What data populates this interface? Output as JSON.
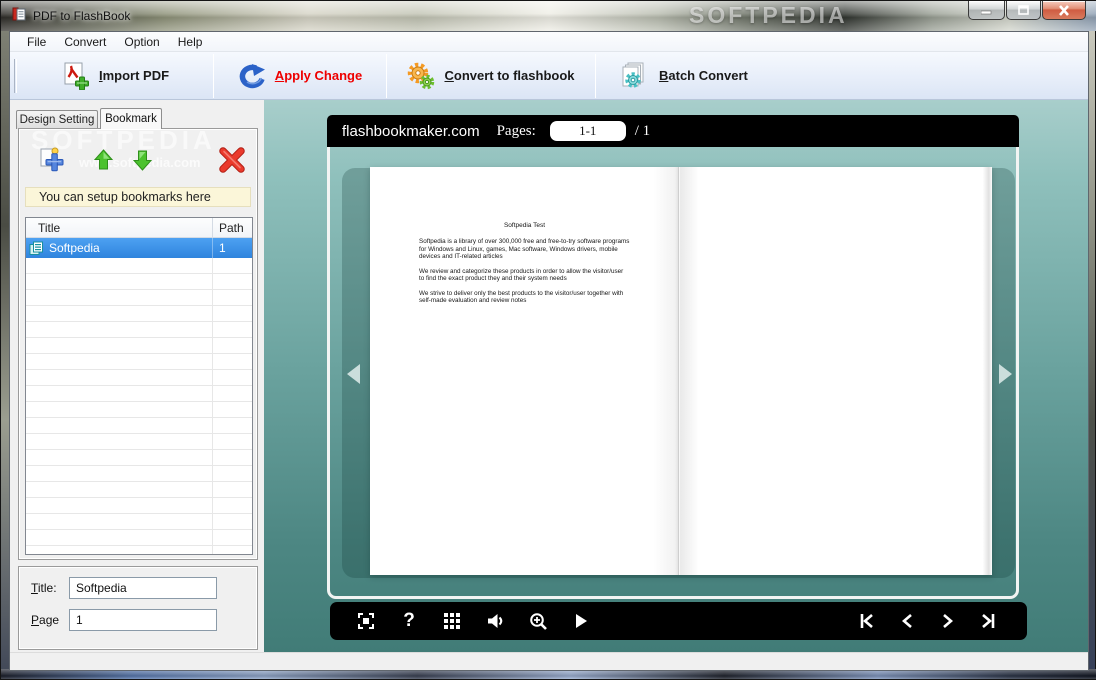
{
  "window": {
    "title": "PDF to FlashBook",
    "watermark": "SOFTPEDIA",
    "controls": [
      "minimize",
      "maximize",
      "close"
    ]
  },
  "menubar": {
    "items": [
      "File",
      "Convert",
      "Option",
      "Help"
    ]
  },
  "toolbar": {
    "buttons": [
      {
        "name": "import-pdf",
        "pre": "",
        "key": "I",
        "post": "mport PDF",
        "color": "#1a1a1a"
      },
      {
        "name": "apply-change",
        "pre": "",
        "key": "A",
        "post": "pply Change",
        "color": "#ee0000"
      },
      {
        "name": "convert-to-flashbook",
        "pre": "",
        "key": "C",
        "post": "onvert to flashbook",
        "color": "#1a1a1a"
      },
      {
        "name": "batch-convert",
        "pre": "",
        "key": "B",
        "post": "atch Convert",
        "color": "#1a1a1a"
      }
    ]
  },
  "sidebar": {
    "tabs": [
      {
        "label": "Design Setting",
        "active": false
      },
      {
        "label": "Bookmark",
        "active": true
      }
    ],
    "watermark_line1": "SOFTPEDIA",
    "watermark_line2": "www.softpedia.com",
    "action_icons": [
      "add-bookmark",
      "move-up",
      "move-down",
      "delete"
    ],
    "hint": "You can setup bookmarks here",
    "table": {
      "columns": [
        "Title",
        "Path"
      ],
      "rows": [
        {
          "title": "Softpedia",
          "path": "1",
          "selected": true
        }
      ],
      "empty_rows": 20
    },
    "fields": {
      "title": {
        "pre": "",
        "key": "T",
        "post": "itle:",
        "value": "Softpedia"
      },
      "page": {
        "pre": "",
        "key": "P",
        "post": "age",
        "value": "1"
      }
    }
  },
  "viewer": {
    "site": "flashbookmaker.com",
    "pages_label": "Pages:",
    "pages_value": "1-1",
    "pages_total": "/ 1",
    "book": {
      "page_title": "Softpedia Test",
      "paragraphs": [
        "Softpedia is a library of over 300,000 free and free-to-try software programs for Windows and Linux, games, Mac software, Windows drivers, mobile devices and IT-related articles",
        "We review and categorize these products in order to allow the visitor/user to find the exact product they and their system needs",
        "We strive to deliver only the best products to the visitor/user together with self-made evaluation and review notes"
      ]
    },
    "toolbar_icons": [
      "fullscreen",
      "help",
      "thumbnails",
      "sound",
      "zoom-in",
      "play"
    ],
    "nav_icons": [
      "first-page",
      "prev-page",
      "next-page",
      "last-page"
    ],
    "colors": {
      "teal_top": "#a8cecb",
      "teal_bottom": "#417c77",
      "bar": "#000000",
      "selection": "#3390e8"
    }
  }
}
